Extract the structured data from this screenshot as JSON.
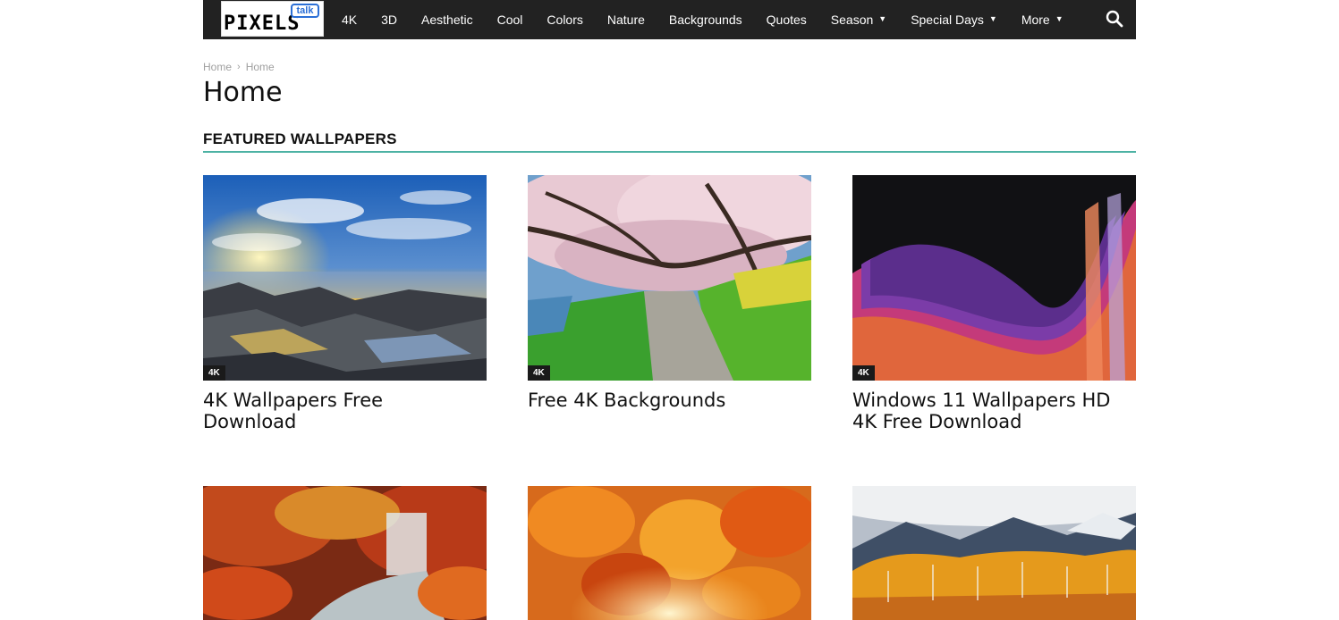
{
  "header": {
    "logo_main": "PIXELS",
    "logo_bubble": "talk",
    "nav": [
      {
        "label": "4K",
        "has_caret": false
      },
      {
        "label": "3D",
        "has_caret": false
      },
      {
        "label": "Aesthetic",
        "has_caret": false
      },
      {
        "label": "Cool",
        "has_caret": false
      },
      {
        "label": "Colors",
        "has_caret": false
      },
      {
        "label": "Nature",
        "has_caret": false
      },
      {
        "label": "Backgrounds",
        "has_caret": false
      },
      {
        "label": "Quotes",
        "has_caret": false
      },
      {
        "label": "Season",
        "has_caret": true
      },
      {
        "label": "Special Days",
        "has_caret": true
      },
      {
        "label": "More",
        "has_caret": true
      }
    ],
    "search_icon": "search-icon"
  },
  "breadcrumb": {
    "items": [
      "Home",
      "Home"
    ],
    "separator": "›"
  },
  "page": {
    "title": "Home"
  },
  "featured": {
    "heading": "FEATURED WALLPAPERS",
    "accent_color": "#4db2a4",
    "cards": [
      {
        "title": "4K Wallpapers Free Download",
        "badge": "4K",
        "image": "rocky-sea-sunset"
      },
      {
        "title": "Free 4K Backgrounds",
        "badge": "4K",
        "image": "cherry-blossom-path"
      },
      {
        "title": "Windows 11 Wallpapers HD 4K Free Download",
        "badge": "4K",
        "image": "purple-abstract-waves"
      },
      {
        "title": "",
        "badge": "",
        "image": "autumn-waterfall"
      },
      {
        "title": "",
        "badge": "",
        "image": "orange-autumn-leaves"
      },
      {
        "title": "",
        "badge": "",
        "image": "autumn-mountain-forest"
      }
    ]
  }
}
